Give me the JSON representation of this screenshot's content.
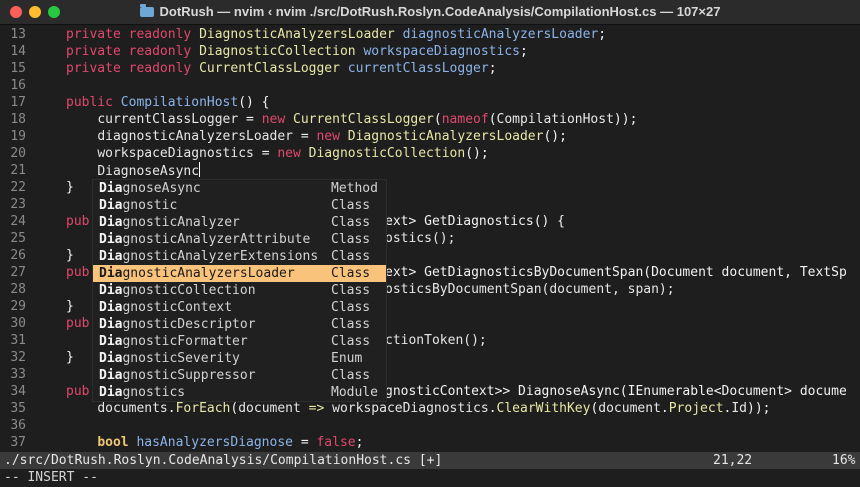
{
  "window": {
    "title": "DotRush — nvim ‹ nvim ./src/DotRush.Roslyn.CodeAnalysis/CompilationHost.cs — 107×27",
    "folder_icon": "folder-icon"
  },
  "lines": [
    {
      "n": "13",
      "text": "    private readonly DiagnosticAnalyzersLoader diagnosticAnalyzersLoader;"
    },
    {
      "n": "14",
      "text": "    private readonly DiagnosticCollection workspaceDiagnostics;"
    },
    {
      "n": "15",
      "text": "    private readonly CurrentClassLogger currentClassLogger;"
    },
    {
      "n": "16",
      "text": ""
    },
    {
      "n": "17",
      "text": "    public CompilationHost() {"
    },
    {
      "n": "18",
      "text": "        currentClassLogger = new CurrentClassLogger(nameof(CompilationHost));"
    },
    {
      "n": "19",
      "text": "        diagnosticAnalyzersLoader = new DiagnosticAnalyzersLoader();"
    },
    {
      "n": "20",
      "text": "        workspaceDiagnostics = new DiagnosticCollection();"
    },
    {
      "n": "21",
      "text": "        DiagnoseAsync"
    },
    {
      "n": "22",
      "text": "    }"
    },
    {
      "n": "23",
      "text": ""
    },
    {
      "n": "24",
      "text": "    pub"
    },
    {
      "n": "25",
      "text": ""
    },
    {
      "n": "26",
      "text": "    }"
    },
    {
      "n": "27",
      "text": "    pub"
    },
    {
      "n": "28",
      "text": ""
    },
    {
      "n": "29",
      "text": "    }"
    },
    {
      "n": "30",
      "text": "    pub"
    },
    {
      "n": "31",
      "text": ""
    },
    {
      "n": "32",
      "text": "    }"
    },
    {
      "n": "33",
      "text": ""
    },
    {
      "n": "34",
      "text": "    pub"
    },
    {
      "n": "35",
      "text": "        documents.ForEach(document => workspaceDiagnostics.ClearWithKey(document.Project.Id));"
    },
    {
      "n": "36",
      "text": ""
    },
    {
      "n": "37",
      "text": "        bool hasAnalyzersDiagnose = false;"
    }
  ],
  "behind_popup": {
    "l24": "ext> GetDiagnostics() {",
    "l25": "ostics();",
    "l27": "ext> GetDiagnosticsByDocumentSpan(Document document, TextSp",
    "l28": "osticsByDocumentSpan(document, span);",
    "l31": "ctionToken();",
    "l34": "gnosticContext>> DiagnoseAsync(IEnumerable<Document> docume"
  },
  "completion": {
    "typed_prefix": "Dia",
    "items": [
      {
        "rest": "gnoseAsync",
        "kind": "Method"
      },
      {
        "rest": "gnostic",
        "kind": "Class"
      },
      {
        "rest": "gnosticAnalyzer",
        "kind": "Class"
      },
      {
        "rest": "gnosticAnalyzerAttribute",
        "kind": "Class"
      },
      {
        "rest": "gnosticAnalyzerExtensions",
        "kind": "Class"
      },
      {
        "rest": "gnosticAnalyzersLoader",
        "kind": "Class",
        "selected": true
      },
      {
        "rest": "gnosticCollection",
        "kind": "Class"
      },
      {
        "rest": "gnosticContext",
        "kind": "Class"
      },
      {
        "rest": "gnosticDescriptor",
        "kind": "Class"
      },
      {
        "rest": "gnosticFormatter",
        "kind": "Class"
      },
      {
        "rest": "gnosticSeverity",
        "kind": "Enum"
      },
      {
        "rest": "gnosticSuppressor",
        "kind": "Class"
      },
      {
        "rest": "gnostics",
        "kind": "Module"
      }
    ]
  },
  "status": {
    "file": "./src/DotRush.Roslyn.CodeAnalysis/CompilationHost.cs [+]",
    "position": "21,22",
    "percent": "16%"
  },
  "mode": "-- INSERT --",
  "colors": {
    "selected_item": "#f9c37c",
    "keyword": "#e0486d",
    "type": "#e7e7a6",
    "field": "#8bb3e8"
  }
}
